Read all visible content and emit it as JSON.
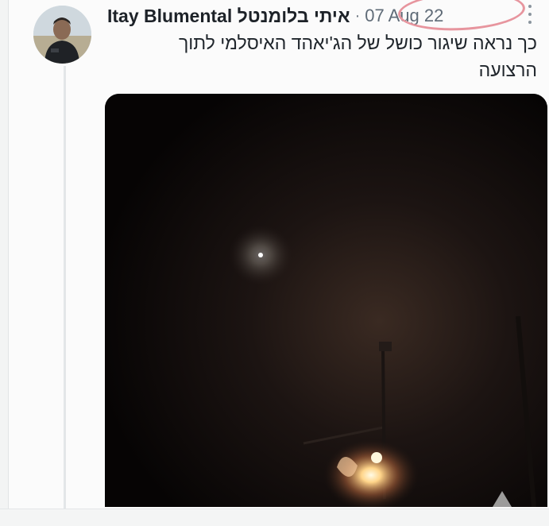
{
  "tweet": {
    "author_name": "Itay Blumental איתי בלומנטל",
    "separator": "·",
    "date": "07 Aug 22",
    "text": "כך נראה שיגור כושל של הג'יאהד האיסלמי לתוך הרצועה"
  },
  "icons": {
    "more": "more-options-icon"
  },
  "colors": {
    "name_text": "#1d2228",
    "date_text": "#5f6b77",
    "highlight_circle": "#e7959e",
    "media_background": "#0b0808"
  }
}
